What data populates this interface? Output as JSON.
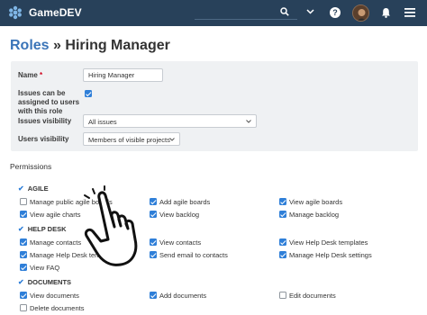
{
  "app": {
    "name": "GameDEV"
  },
  "header": {
    "title_crumb": "Roles",
    "title_separator": "»",
    "title_rest": "Hiring Manager"
  },
  "form": {
    "name_label": "Name",
    "required_mark": "*",
    "name_value": "Hiring Manager",
    "assign_label_line1": "Issues can be",
    "assign_label_line2": "assigned to users",
    "assign_label_line3": "with this role",
    "assign_checked": true,
    "issues_visibility_label": "Issues visibility",
    "issues_visibility_value": "All issues",
    "users_visibility_label": "Users visibility",
    "users_visibility_value": "Members of visible projects"
  },
  "permissions": {
    "title": "Permissions",
    "groups": [
      {
        "name": "AGILE",
        "items": [
          {
            "label": "Manage public agile boards",
            "checked": false
          },
          {
            "label": "Add agile boards",
            "checked": true
          },
          {
            "label": "View agile boards",
            "checked": true
          },
          {
            "label": "View agile charts",
            "checked": true
          },
          {
            "label": "View backlog",
            "checked": true
          },
          {
            "label": "Manage backlog",
            "checked": true
          }
        ]
      },
      {
        "name": "HELP DESK",
        "items": [
          {
            "label": "Manage contacts",
            "checked": true
          },
          {
            "label": "View contacts",
            "checked": true
          },
          {
            "label": "View Help Desk templates",
            "checked": true
          },
          {
            "label": "Manage Help Desk templates",
            "checked": true
          },
          {
            "label": "Send email to contacts",
            "checked": true
          },
          {
            "label": "Manage Help Desk settings",
            "checked": true
          },
          {
            "label": "View FAQ",
            "checked": true
          }
        ]
      },
      {
        "name": "DOCUMENTS",
        "items": [
          {
            "label": "View documents",
            "checked": true
          },
          {
            "label": "Add documents",
            "checked": true
          },
          {
            "label": "Edit documents",
            "checked": false
          },
          {
            "label": "Delete documents",
            "checked": false
          }
        ]
      }
    ]
  },
  "colors": {
    "topbar": "#28415a",
    "accent": "#2f7fd8",
    "link": "#3a74b8"
  },
  "icons": [
    "logo-icon",
    "search-icon",
    "chevron-down-icon",
    "help-icon",
    "bell-icon",
    "menu-icon",
    "pointer-hand-icon"
  ]
}
